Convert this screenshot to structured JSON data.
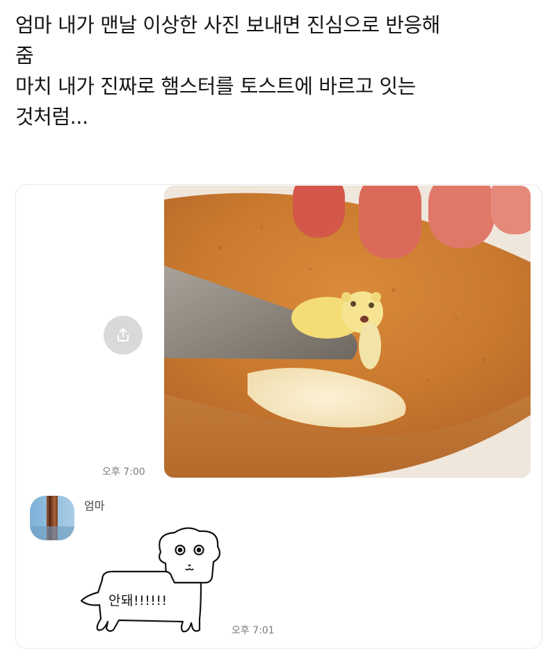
{
  "caption": {
    "lines": [
      "엄마 내가 맨날 이상한 사진 보내면 진심으로 반응해",
      "줌",
      "마치 내가 진짜로 햄스터를 토스트에 바르고 잇는",
      "것처럼..."
    ]
  },
  "chat": {
    "outgoing": {
      "time": "오후 7:00",
      "share_icon": "share-icon",
      "photo": "toast-with-butter-hamster"
    },
    "incoming": {
      "sender": "엄마",
      "sticker_text": "안돼!!!!!!",
      "time": "오후 7:01"
    }
  },
  "colors": {
    "share_button": "#d9d9d9",
    "timestamp": "#7a7a7a",
    "card_border": "#e9e9e9"
  }
}
